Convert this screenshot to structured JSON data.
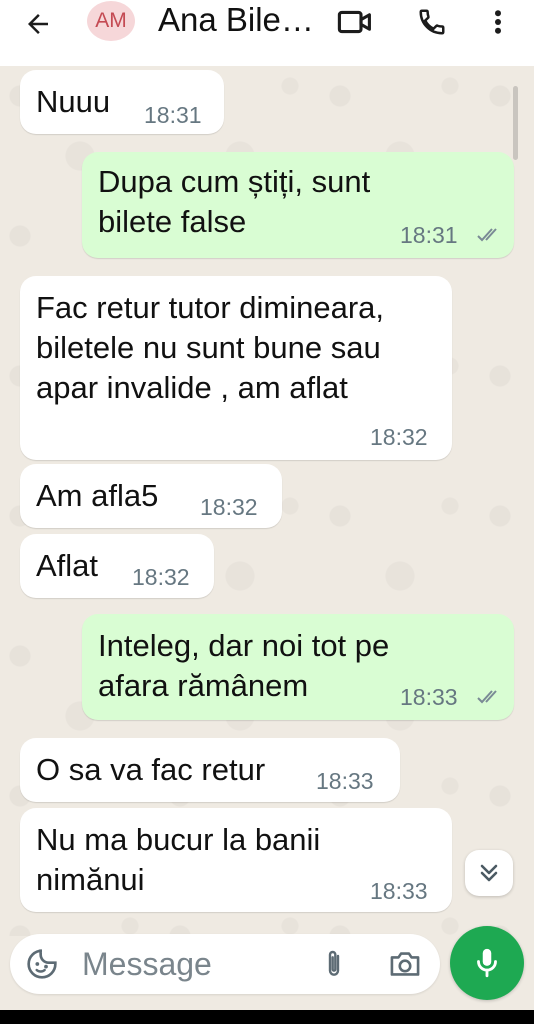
{
  "header": {
    "avatar_initials": "AM",
    "contact_name": "Ana Bile…"
  },
  "colors": {
    "incoming_bubble": "#ffffff",
    "outgoing_bubble": "#d9fdd3",
    "accent_green": "#1ea952",
    "chat_background": "#efeae2"
  },
  "messages": [
    {
      "direction": "incoming",
      "lines": [
        "Nuuu"
      ],
      "time": "18:31"
    },
    {
      "direction": "outgoing",
      "lines": [
        "Dupa cum știți, sunt",
        "bilete false"
      ],
      "time": "18:31",
      "status": "read"
    },
    {
      "direction": "incoming",
      "lines": [
        "Fac retur tutor dimineara,",
        "biletele nu sunt bune sau",
        "apar invalide , am aflat"
      ],
      "time": "18:32"
    },
    {
      "direction": "incoming",
      "lines": [
        "Am afla5"
      ],
      "time": "18:32"
    },
    {
      "direction": "incoming",
      "lines": [
        "Aflat"
      ],
      "time": "18:32"
    },
    {
      "direction": "outgoing",
      "lines": [
        "Inteleg, dar noi tot pe",
        "afara rămânem"
      ],
      "time": "18:33",
      "status": "read"
    },
    {
      "direction": "incoming",
      "lines": [
        "O sa va fac retur"
      ],
      "time": "18:33"
    },
    {
      "direction": "incoming",
      "lines": [
        "Nu ma bucur la banii",
        "nimănui"
      ],
      "time": "18:33"
    }
  ],
  "composer": {
    "placeholder": "Message"
  },
  "icons": {
    "back": "arrow-left-icon",
    "video": "video-camera-icon",
    "call": "phone-icon",
    "menu": "more-vertical-icon",
    "emoji": "emoji-sticker-icon",
    "attach": "paperclip-icon",
    "camera": "camera-icon",
    "mic": "microphone-icon",
    "scroll": "chevron-double-down-icon"
  }
}
